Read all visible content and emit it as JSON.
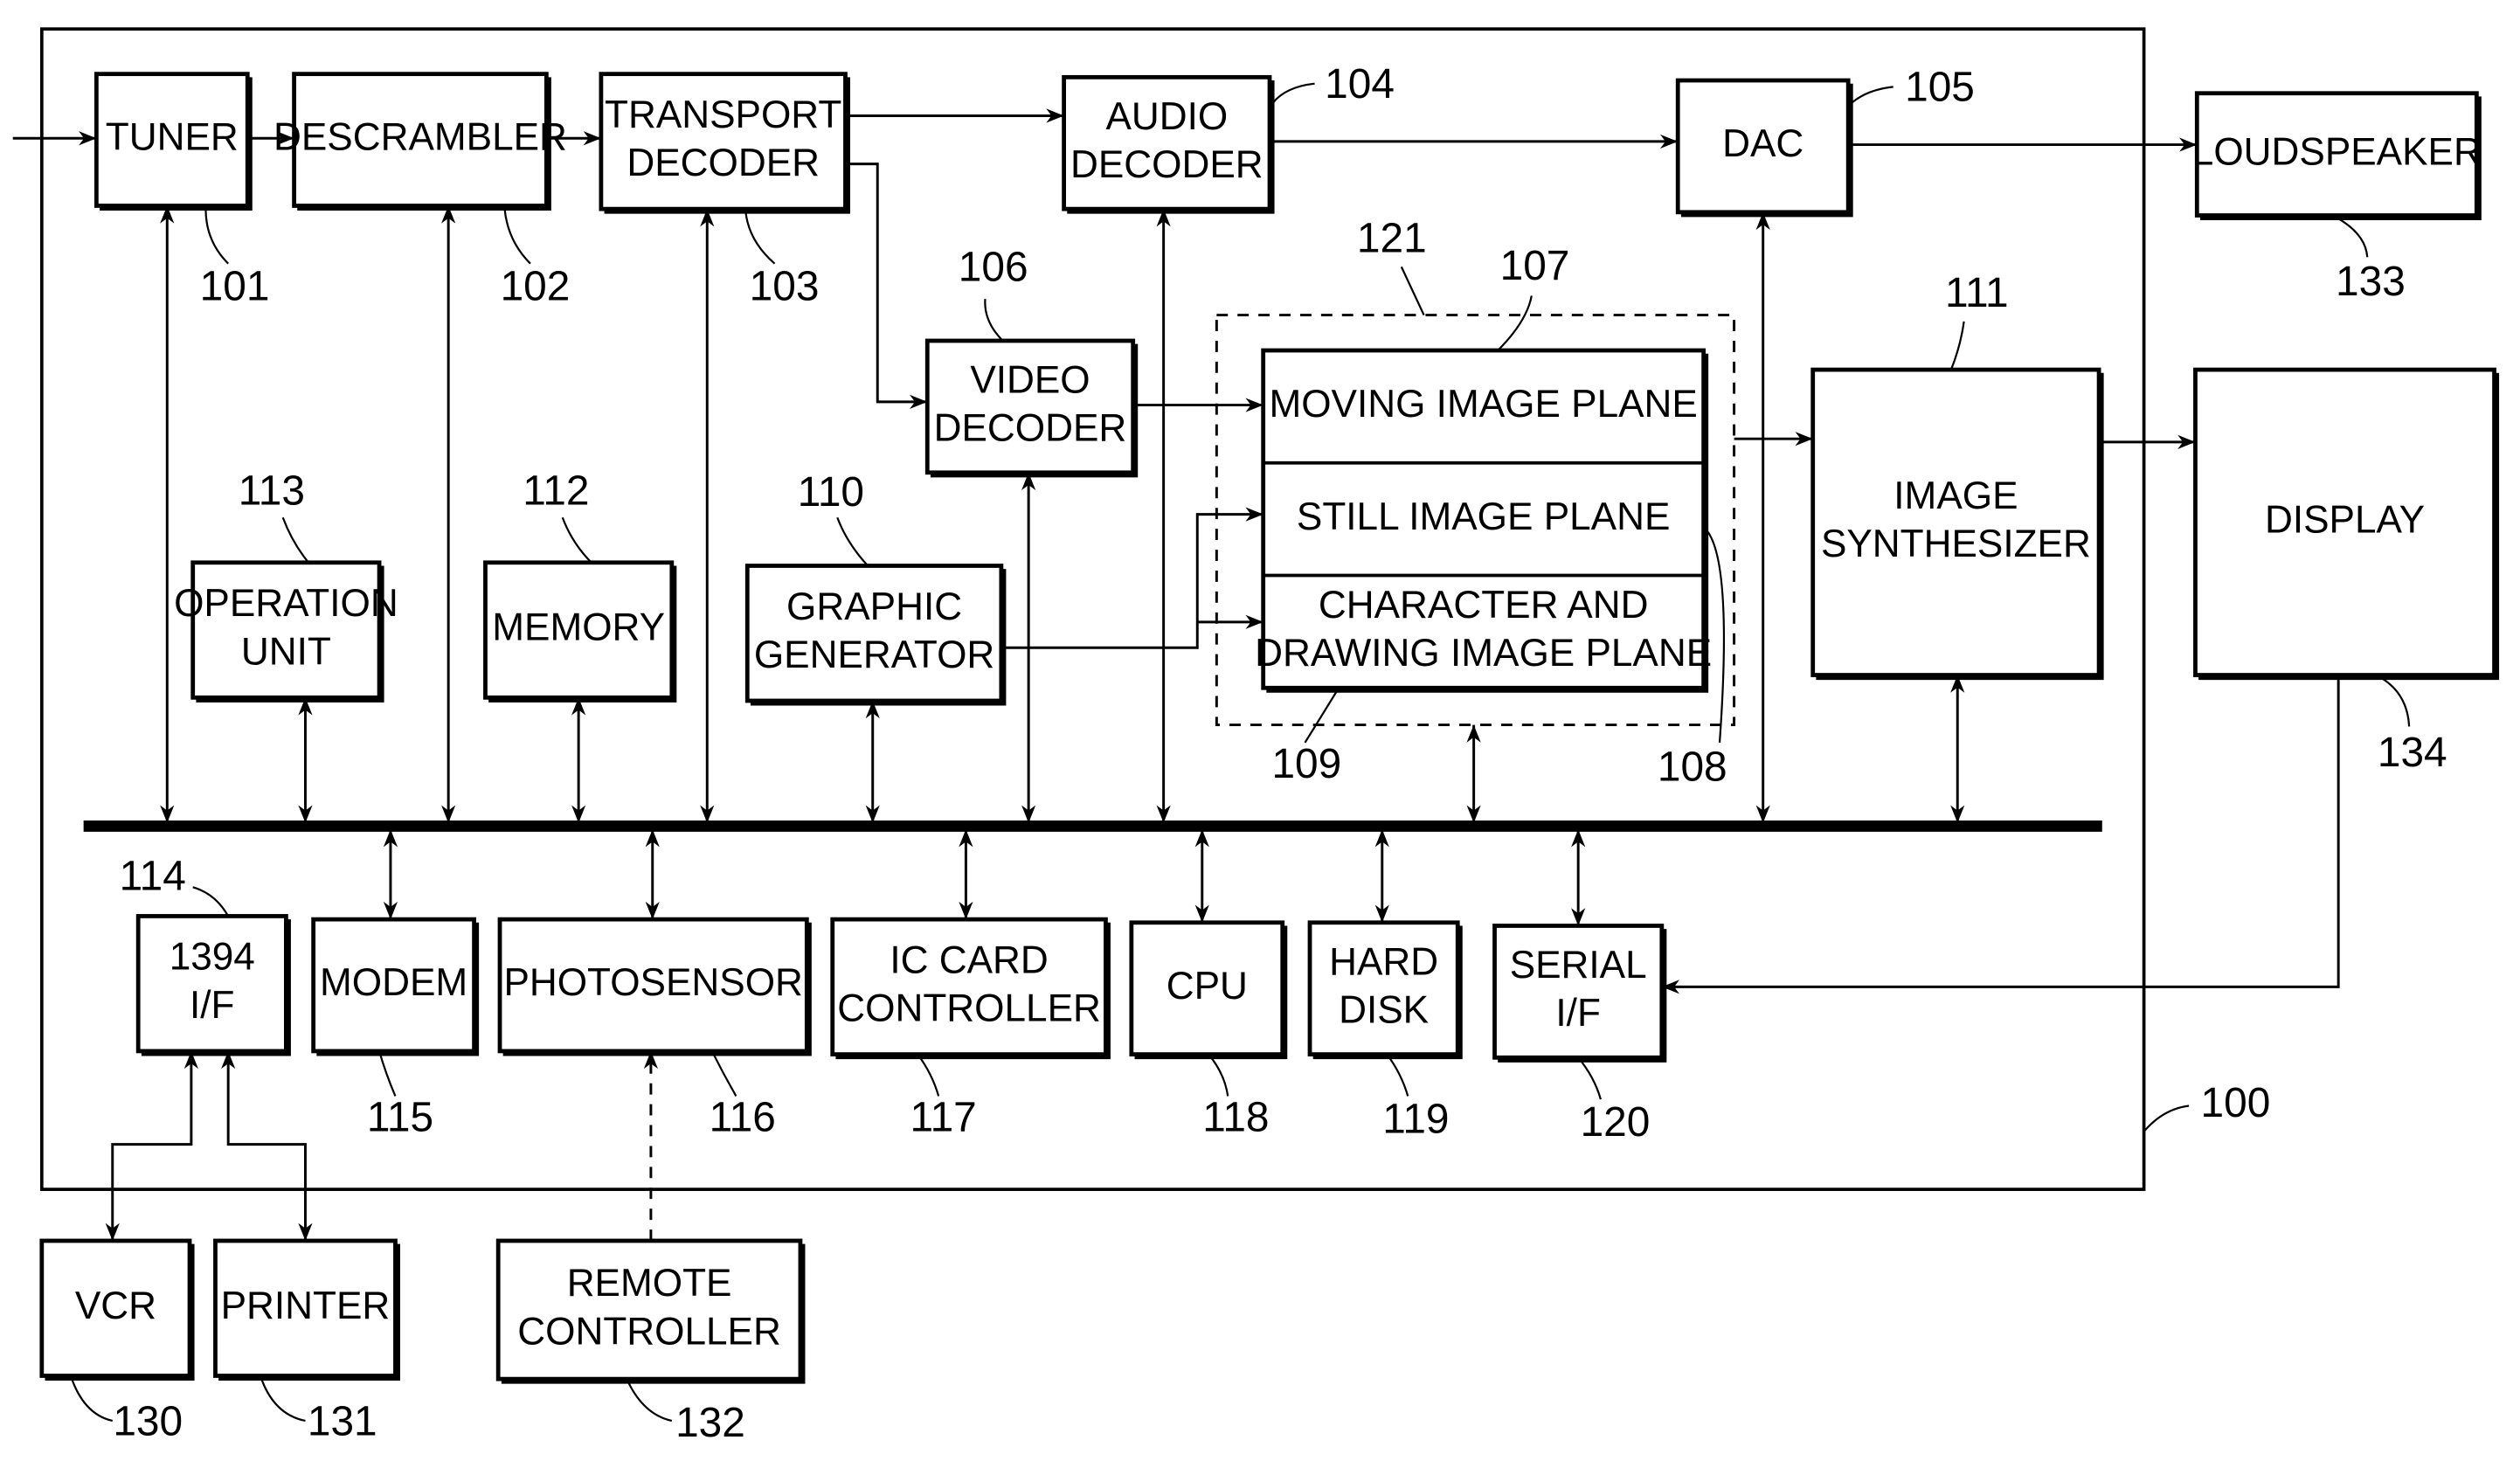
{
  "figure": {
    "type": "block-diagram",
    "system_ref": "100",
    "bus_label": "",
    "blocks": {
      "tuner": {
        "label": [
          "TUNER"
        ],
        "ref": "101"
      },
      "descrambler": {
        "label": [
          "DESCRAMBLER"
        ],
        "ref": "102"
      },
      "transport_decoder": {
        "label": [
          "TRANSPORT",
          "DECODER"
        ],
        "ref": "103"
      },
      "audio_decoder": {
        "label": [
          "AUDIO",
          "DECODER"
        ],
        "ref": "104"
      },
      "dac": {
        "label": [
          "DAC"
        ],
        "ref": "105"
      },
      "video_decoder": {
        "label": [
          "VIDEO",
          "DECODER"
        ],
        "ref": "106"
      },
      "moving_image_plane": {
        "label": [
          "MOVING IMAGE PLANE"
        ],
        "ref": "107"
      },
      "still_image_plane": {
        "label": [
          "STILL IMAGE PLANE"
        ],
        "ref": "108"
      },
      "character_drawing_plane": {
        "label": [
          "CHARACTER AND",
          "DRAWING IMAGE PLANE"
        ],
        "ref": "109"
      },
      "graphic_generator": {
        "label": [
          "GRAPHIC",
          "GENERATOR"
        ],
        "ref": "110"
      },
      "image_synthesizer": {
        "label": [
          "IMAGE",
          "SYNTHESIZER"
        ],
        "ref": "111"
      },
      "memory": {
        "label": [
          "MEMORY"
        ],
        "ref": "112"
      },
      "operation_unit": {
        "label": [
          "OPERATION",
          "UNIT"
        ],
        "ref": "113"
      },
      "if_1394": {
        "label": [
          "1394",
          "I/F"
        ],
        "ref": "114"
      },
      "modem": {
        "label": [
          "MODEM"
        ],
        "ref": "115"
      },
      "photosensor": {
        "label": [
          "PHOTOSENSOR"
        ],
        "ref": "116"
      },
      "ic_card_controller": {
        "label": [
          "IC CARD",
          "CONTROLLER"
        ],
        "ref": "117"
      },
      "cpu": {
        "label": [
          "CPU"
        ],
        "ref": "118"
      },
      "hard_disk": {
        "label": [
          "HARD",
          "DISK"
        ],
        "ref": "119"
      },
      "serial_if": {
        "label": [
          "SERIAL",
          "I/F"
        ],
        "ref": "120"
      },
      "plane_group": {
        "label": [],
        "ref": "121"
      },
      "vcr": {
        "label": [
          "VCR"
        ],
        "ref": "130"
      },
      "printer": {
        "label": [
          "PRINTER"
        ],
        "ref": "131"
      },
      "remote_controller": {
        "label": [
          "REMOTE",
          "CONTROLLER"
        ],
        "ref": "132"
      },
      "loudspeaker": {
        "label": [
          "LOUDSPEAKER"
        ],
        "ref": "133"
      },
      "display": {
        "label": [
          "DISPLAY"
        ],
        "ref": "134"
      }
    }
  }
}
